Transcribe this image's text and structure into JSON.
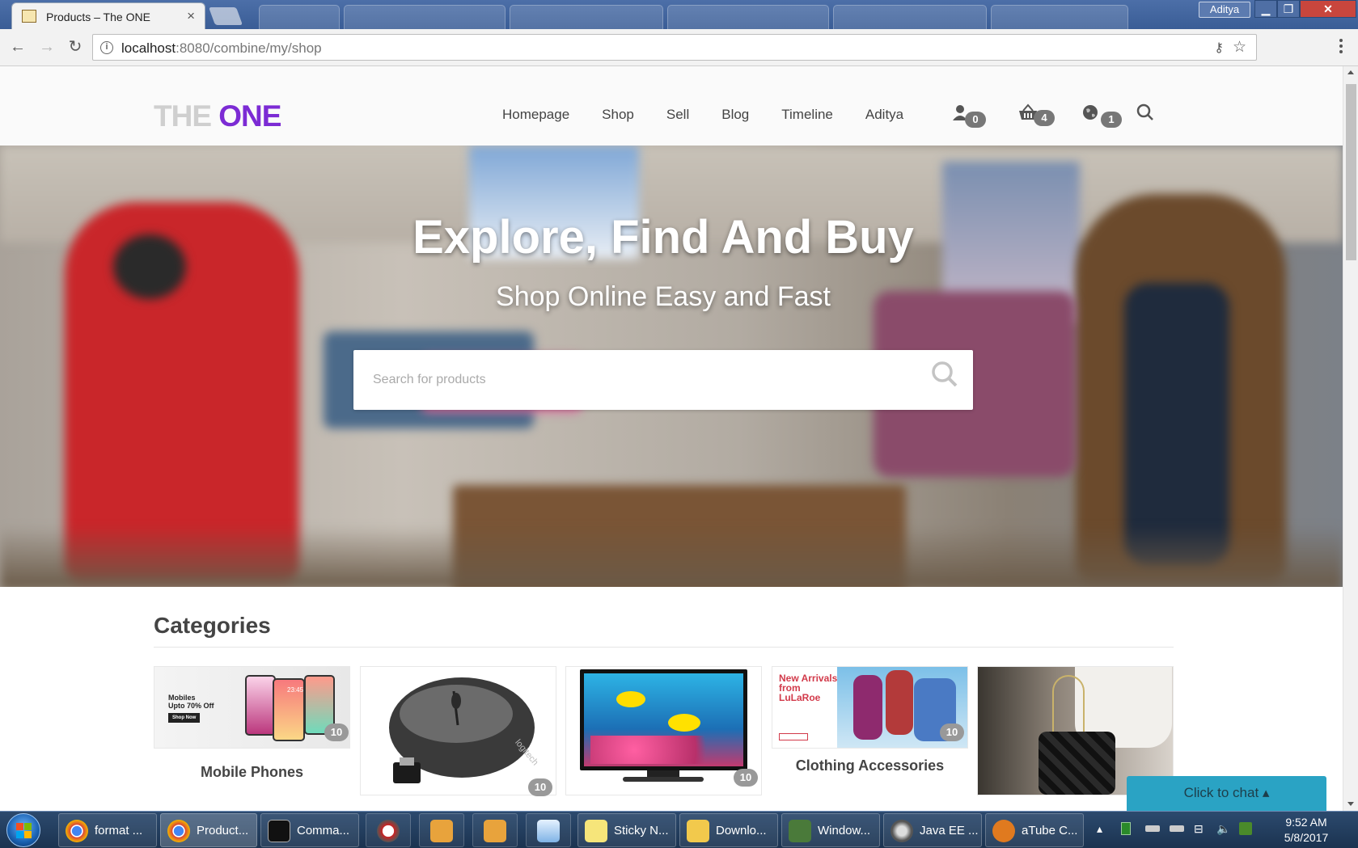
{
  "browser": {
    "tab_title": "Products – The ONE",
    "tab_close": "×",
    "url_host": "localhost",
    "url_rest": ":8080/combine/my/shop",
    "window_user": "Aditya",
    "window_controls": {
      "minimize": "▁",
      "maximize": "❐",
      "close": "✕"
    },
    "nav": {
      "back": "←",
      "forward": "→",
      "reload": "↻"
    }
  },
  "site": {
    "logo_part1": "THE",
    "logo_part2": "ONE",
    "nav": [
      "Homepage",
      "Shop",
      "Sell",
      "Blog",
      "Timeline",
      "Aditya"
    ],
    "counters": {
      "user": "0",
      "cart": "4",
      "globe": "1"
    },
    "colors": {
      "brand": "#7c2bd4",
      "chat": "#2aa3c4"
    }
  },
  "hero": {
    "title": "Explore, Find And Buy",
    "subtitle": "Shop Online Easy and Fast",
    "search_placeholder": "Search for products"
  },
  "categories": {
    "heading": "Categories",
    "items": [
      {
        "name": "Mobile Phones",
        "count": "10",
        "banner_line1": "Mobiles",
        "banner_line2": "Upto 70% Off",
        "banner_cta": "Shop Now",
        "clock": "23:45"
      },
      {
        "name": "",
        "count": "10",
        "brand": "logitech"
      },
      {
        "name": "",
        "count": "10"
      },
      {
        "name": "Clothing Accessories",
        "count": "10",
        "banner_line1": "New Arrivals",
        "banner_line2": "from",
        "banner_line3": "LuLaRoe"
      },
      {
        "name": "",
        "count": ""
      }
    ]
  },
  "chat": {
    "label": "Click to chat ▴"
  },
  "taskbar": {
    "items": [
      {
        "label": "format ..."
      },
      {
        "label": "Product..."
      },
      {
        "label": "Comma..."
      },
      {
        "label": "Sticky N..."
      },
      {
        "label": "Downlo..."
      },
      {
        "label": "Window..."
      },
      {
        "label": "Java EE ..."
      },
      {
        "label": "aTube C..."
      }
    ],
    "time": "9:52 AM",
    "date": "5/8/2017"
  }
}
